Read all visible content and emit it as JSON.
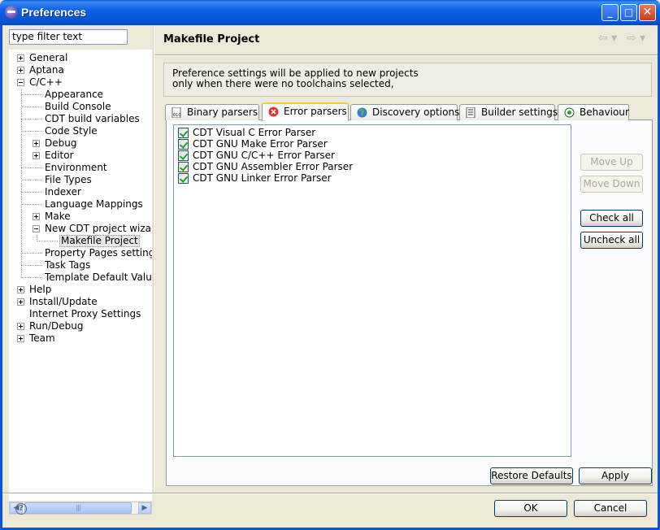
{
  "window": {
    "title": "Preferences"
  },
  "titlebar_buttons": {
    "minimize": "_",
    "maximize": "□",
    "close": "✕"
  },
  "filter": {
    "value": "type filter text"
  },
  "tree": [
    {
      "label": "General",
      "level": 0,
      "expander": "plus"
    },
    {
      "label": "Aptana",
      "level": 0,
      "expander": "plus"
    },
    {
      "label": "C/C++",
      "level": 0,
      "expander": "minus"
    },
    {
      "label": "Appearance",
      "level": 1,
      "expander": ""
    },
    {
      "label": "Build Console",
      "level": 1,
      "expander": ""
    },
    {
      "label": "CDT build variables",
      "level": 1,
      "expander": ""
    },
    {
      "label": "Code Style",
      "level": 1,
      "expander": ""
    },
    {
      "label": "Debug",
      "level": 1,
      "expander": "plus"
    },
    {
      "label": "Editor",
      "level": 1,
      "expander": "plus"
    },
    {
      "label": "Environment",
      "level": 1,
      "expander": ""
    },
    {
      "label": "File Types",
      "level": 1,
      "expander": ""
    },
    {
      "label": "Indexer",
      "level": 1,
      "expander": ""
    },
    {
      "label": "Language Mappings",
      "level": 1,
      "expander": ""
    },
    {
      "label": "Make",
      "level": 1,
      "expander": "plus"
    },
    {
      "label": "New CDT project wizar",
      "level": 1,
      "expander": "minus"
    },
    {
      "label": "Makefile Project",
      "level": 2,
      "expander": "",
      "selected": true
    },
    {
      "label": "Property Pages setting:",
      "level": 1,
      "expander": ""
    },
    {
      "label": "Task Tags",
      "level": 1,
      "expander": ""
    },
    {
      "label": "Template Default Value",
      "level": 1,
      "expander": ""
    },
    {
      "label": "Help",
      "level": 0,
      "expander": "plus"
    },
    {
      "label": "Install/Update",
      "level": 0,
      "expander": "plus"
    },
    {
      "label": "Internet Proxy Settings",
      "level": 0,
      "expander": ""
    },
    {
      "label": "Run/Debug",
      "level": 0,
      "expander": "plus"
    },
    {
      "label": "Team",
      "level": 0,
      "expander": "plus"
    }
  ],
  "page": {
    "title": "Makefile Project",
    "info_line1": "Preference settings will be applied to new projects",
    "info_line2": "only when there were no toolchains selected,"
  },
  "tabs": [
    {
      "label": "Binary parsers",
      "icon": "binary-file-icon"
    },
    {
      "label": "Error parsers",
      "icon": "error-icon",
      "active": true
    },
    {
      "label": "Discovery options",
      "icon": "globe-icon"
    },
    {
      "label": "Builder settings",
      "icon": "document-list-icon"
    },
    {
      "label": "Behaviour",
      "icon": "radio-icon"
    }
  ],
  "parsers": [
    {
      "label": "CDT Visual C Error Parser",
      "checked": true
    },
    {
      "label": "CDT GNU Make Error Parser",
      "checked": true
    },
    {
      "label": "CDT GNU C/C++ Error Parser",
      "checked": true
    },
    {
      "label": "CDT GNU Assembler Error Parser",
      "checked": true
    },
    {
      "label": "CDT GNU Linker Error Parser",
      "checked": true
    }
  ],
  "side_buttons": {
    "move_up": "Move Up",
    "move_down": "Move Down",
    "check_all": "Check all",
    "uncheck_all": "Uncheck all"
  },
  "footer": {
    "restore_defaults": "Restore Defaults",
    "apply": "Apply",
    "ok": "OK",
    "cancel": "Cancel",
    "help": "?"
  },
  "colors": {
    "titlebar": "#0a5ad6",
    "selection_border": "#ffc83c",
    "check": "#21a121"
  }
}
